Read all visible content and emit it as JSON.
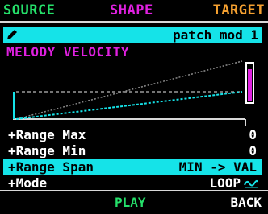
{
  "tabs": {
    "source": "SOURCE",
    "shape": "SHAPE",
    "target": "TARGET"
  },
  "colors": {
    "source": "#25e06a",
    "shape": "#e020e0",
    "target": "#f5a030",
    "accent": "#15e3e8"
  },
  "titlebar": {
    "icon": "pencil-icon",
    "title": "patch mod 1"
  },
  "subtitle": "MELODY VELOCITY",
  "params": [
    {
      "label": "+Range Max",
      "value": "0"
    },
    {
      "label": "+Range Min",
      "value": "0"
    },
    {
      "label": "+Range Span",
      "value": "MIN -> VAL",
      "selected": true
    },
    {
      "label": "+Mode",
      "value": "LOOP",
      "icon": "wave-icon"
    }
  ],
  "footer": {
    "play": "PLAY",
    "back": "BACK"
  }
}
